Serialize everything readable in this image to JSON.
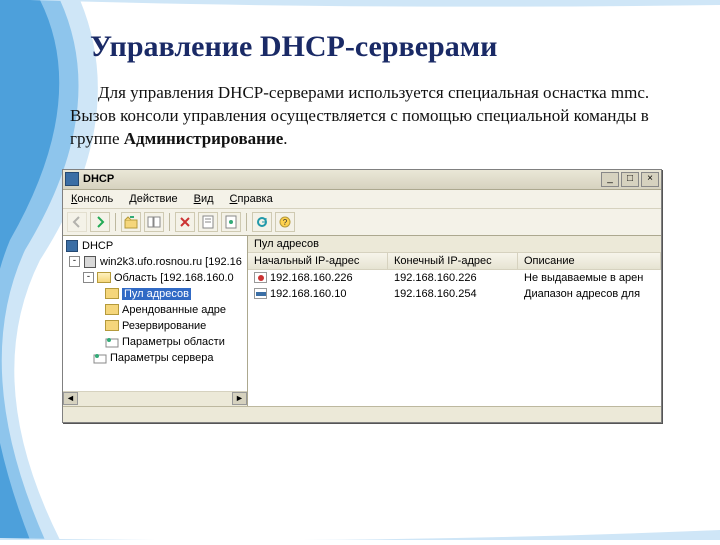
{
  "slide": {
    "title": "Управление DHCP-серверами",
    "paragraph_pre": "Для управления DHCP-серверами используется специальная оснастка mmc. Вызов консоли управления осуществляется с помощью специальной команды в группе ",
    "paragraph_bold": "Администрирование",
    "paragraph_post": "."
  },
  "mmc": {
    "window_title": "DHCP",
    "menu": {
      "console": "Консоль",
      "action": "Действие",
      "view": "Вид",
      "help": "Справка"
    },
    "tree": {
      "root": "DHCP",
      "server": "win2k3.ufo.rosnou.ru [192.16",
      "scope": "Область [192.168.160.0",
      "pool": "Пул адресов",
      "leases": "Арендованные адре",
      "reservations": "Резервирование",
      "scope_options": "Параметры области",
      "server_options": "Параметры сервера"
    },
    "list": {
      "title": "Пул адресов",
      "columns": {
        "start": "Начальный IP-адрес",
        "end": "Конечный IP-адрес",
        "desc": "Описание"
      },
      "rows": [
        {
          "icon": "red",
          "start": "192.168.160.226",
          "end": "192.168.160.226",
          "desc": "Не выдаваемые в арен"
        },
        {
          "icon": "blue",
          "start": "192.168.160.10",
          "end": "192.168.160.254",
          "desc": "Диапазон адресов для"
        }
      ]
    }
  }
}
